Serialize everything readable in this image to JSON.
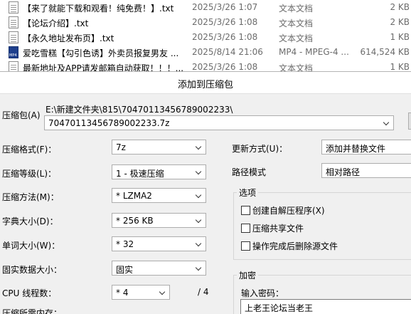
{
  "file_list": {
    "rows": [
      {
        "icon": "text-document-icon",
        "name": "【来了就能下载和观看！纯免费！】.txt",
        "date": "2025/3/26 1:07",
        "type": "文本文档",
        "size": "2 KB"
      },
      {
        "icon": "text-document-icon",
        "name": "【论坛介绍】.txt",
        "date": "2025/3/26 1:08",
        "type": "文本文档",
        "size": "2 KB"
      },
      {
        "icon": "text-document-icon",
        "name": "【永久地址发布页】.txt",
        "date": "2025/3/26 1:08",
        "type": "文本文档",
        "size": "1 KB"
      },
      {
        "icon": "mp4-video-icon",
        "name": "爱吃雪糕【勾引色诱】外卖员报复男友 ...",
        "date": "2025/8/14 21:06",
        "type": "MP4 - MPEG-4 ...",
        "size": "614,524 KB"
      },
      {
        "icon": "text-document-icon",
        "name": "最新地址及APP请发邮箱自动获取！！！...",
        "date": "2025/3/26 1:08",
        "type": "文本文档",
        "size": "1 KB"
      }
    ]
  },
  "dialog": {
    "title": "添加到压缩包",
    "archive_label": "压缩包(A)",
    "archive_path": "E:\\新建文件夹\\815\\70470113456789002233\\",
    "archive_name": "70470113456789002233.7z",
    "left": {
      "format_label": "压缩格式(F)：",
      "format_value": "7z",
      "level_label": "压缩等级(L)：",
      "level_value": "1 - 极速压缩",
      "method_label": "压缩方法(M)：",
      "method_value": "* LZMA2",
      "dict_label": "字典大小(D)：",
      "dict_value": "* 256 KB",
      "word_label": "单词大小(W)：",
      "word_value": "* 32",
      "solid_label": "固实数据大小：",
      "solid_value": "固实",
      "threads_label": "CPU 线程数：",
      "threads_value": "* 4",
      "threads_total": "/ 4",
      "memory_label": "压缩所需内存："
    },
    "right": {
      "update_label": "更新方式(U)：",
      "update_value": "添加并替换文件",
      "path_label": "路径模式",
      "path_value": "相对路径",
      "options_title": "选项",
      "options": [
        {
          "label": "创建自解压程序(X)",
          "checked": false
        },
        {
          "label": "压缩共享文件",
          "checked": false
        },
        {
          "label": "操作完成后删除源文件",
          "checked": false
        }
      ],
      "encrypt_title": "加密",
      "password_label": "输入密码：",
      "password_value": "上老王论坛当老王"
    }
  }
}
